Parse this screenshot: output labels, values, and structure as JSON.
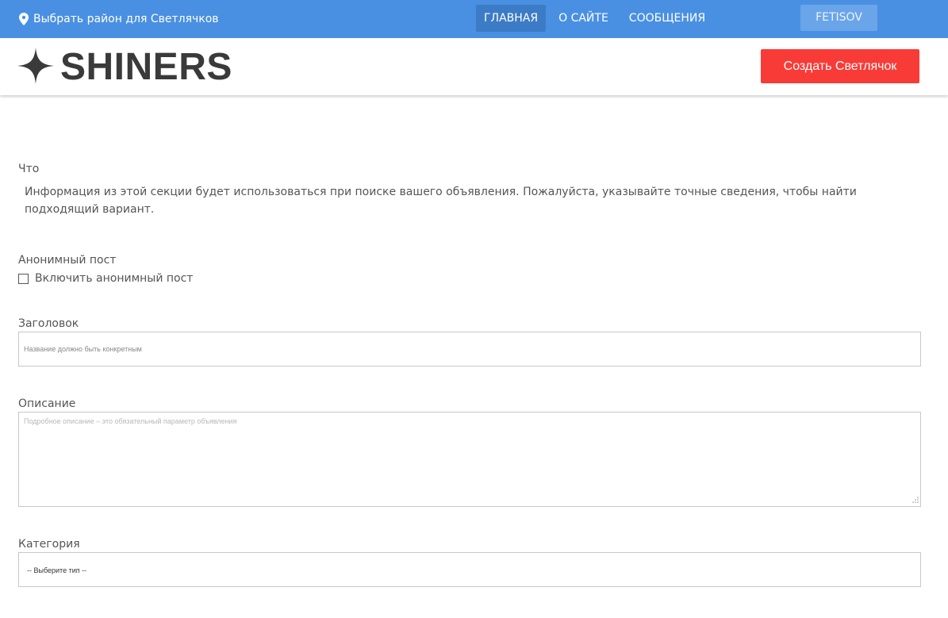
{
  "topbar": {
    "region_label": "Выбрать район для Светлячков",
    "nav": [
      {
        "label": "ГЛАВНАЯ",
        "active": true
      },
      {
        "label": "О САЙТЕ",
        "active": false
      },
      {
        "label": "СООБЩЕНИЯ",
        "active": false
      }
    ],
    "user_label": "FETISOV"
  },
  "header": {
    "logo_text": "SHINERS",
    "create_button": "Создать Светлячок"
  },
  "form": {
    "what": {
      "label": "Что",
      "info": "Информация из этой секции будет использоваться при поиске вашего объявления. Пожалуйста, указывайте точные сведения, чтобы найти подходящий вариант."
    },
    "anonymous": {
      "label": "Анонимный пост",
      "checkbox_label": "Включить анонимный пост",
      "checked": false
    },
    "title": {
      "label": "Заголовок",
      "value": "",
      "placeholder": "Название должно быть конкретным"
    },
    "description": {
      "label": "Описание",
      "value": "",
      "placeholder": "Подробное описание – это обязательный параметр объявления"
    },
    "category": {
      "label": "Категория",
      "selected": "-- Выберите тип --"
    }
  },
  "colors": {
    "topbar_bg": "#4a90e2",
    "nav_active_bg": "#3c7bc6",
    "user_button_bg": "#6aa5ea",
    "create_button_bg": "#f93b37",
    "logo_text": "#3a3a3a",
    "body_text": "#555555"
  },
  "icons": {
    "region": "map-marker-icon",
    "logo": "four-point-star-icon",
    "checkbox": "checkbox-icon",
    "resize": "resize-grip-icon"
  }
}
